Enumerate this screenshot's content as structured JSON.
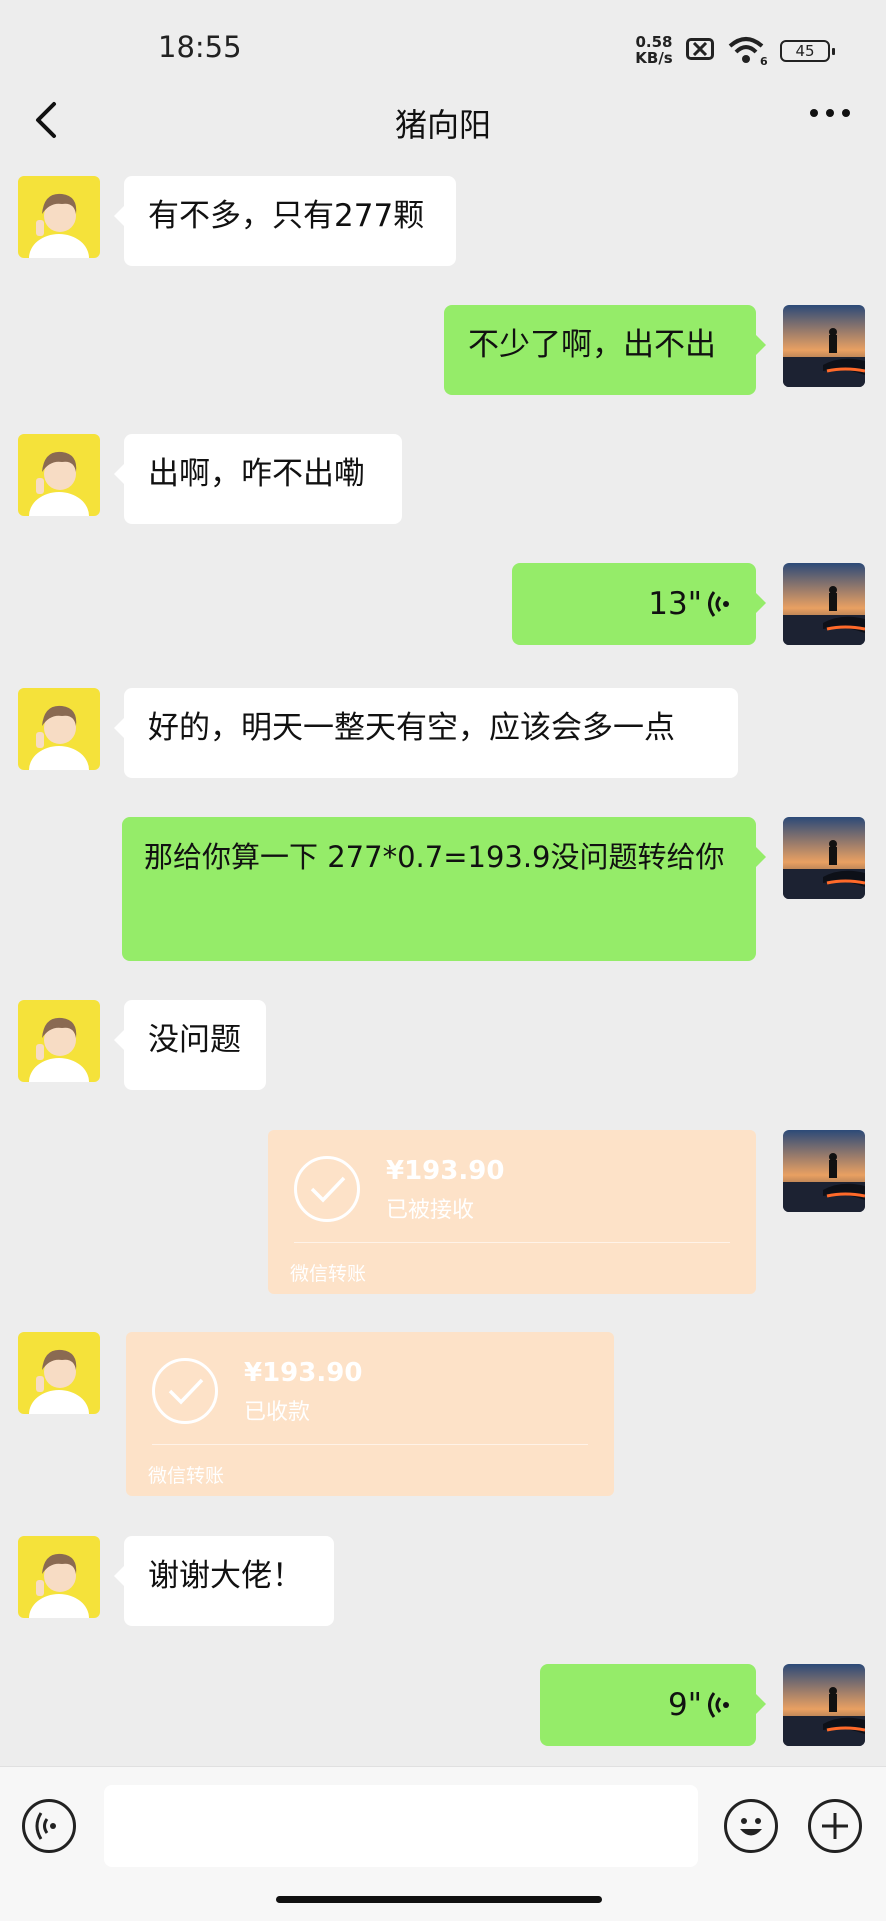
{
  "status": {
    "time": "18:55",
    "net_speed_value": "0.58",
    "net_speed_unit": "KB/s",
    "battery": "45"
  },
  "header": {
    "title": "猪向阳"
  },
  "messages": [
    {
      "side": "left",
      "type": "text",
      "text": "有不多，只有277颗"
    },
    {
      "side": "right",
      "type": "text",
      "text": "不少了啊，出不出"
    },
    {
      "side": "left",
      "type": "text",
      "text": "出啊，咋不出嘞"
    },
    {
      "side": "right",
      "type": "voice",
      "duration": "13\""
    },
    {
      "side": "left",
      "type": "text",
      "text": "好的，明天一整天有空，应该会多一点"
    },
    {
      "side": "right",
      "type": "text",
      "text": "那给你算一下 277*0.7=193.9没问题转给你"
    },
    {
      "side": "left",
      "type": "text",
      "text": "没问题"
    },
    {
      "side": "right",
      "type": "transfer",
      "amount": "¥193.90",
      "status": "已被接收",
      "source": "微信转账"
    },
    {
      "side": "left",
      "type": "transfer",
      "amount": "¥193.90",
      "status": "已收款",
      "source": "微信转账"
    },
    {
      "side": "left",
      "type": "text",
      "text": "谢谢大佬！"
    },
    {
      "side": "right",
      "type": "voice",
      "duration": "9\""
    }
  ],
  "icons": {
    "back": "chevron-left-icon",
    "more": "more-dots-icon",
    "voice_input": "voice-input-icon",
    "emoji": "emoji-icon",
    "plus": "plus-icon",
    "check": "check-icon"
  },
  "colors": {
    "background": "#ededed",
    "bubble_green": "#95ec69",
    "bubble_white": "#ffffff",
    "transfer_faded": "#fde2c8"
  }
}
